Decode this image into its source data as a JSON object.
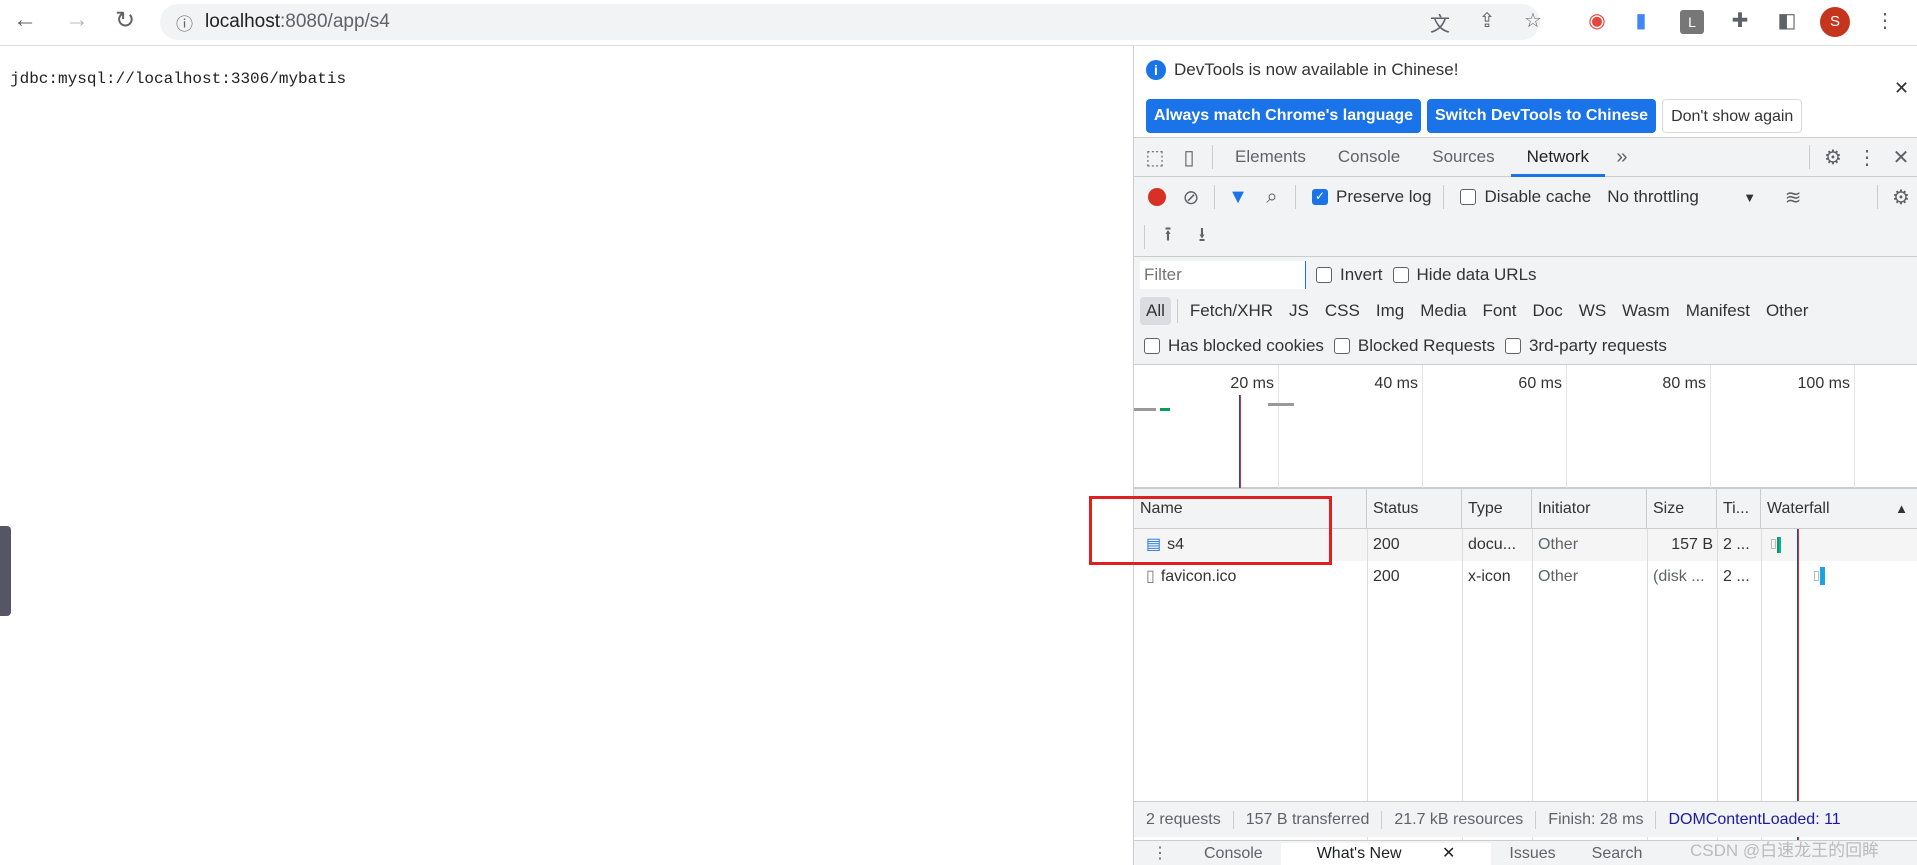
{
  "browser": {
    "url_host": "localhost",
    "url_path": ":8080/app/s4",
    "profile_initial": "S",
    "extension_initial": "L"
  },
  "page": {
    "text": "jdbc:mysql://localhost:3306/mybatis"
  },
  "devtools": {
    "banner": {
      "message": "DevTools is now available in Chinese!",
      "buttons": [
        "Always match Chrome's language",
        "Switch DevTools to Chinese",
        "Don't show again"
      ]
    },
    "tabs": [
      "Elements",
      "Console",
      "Sources",
      "Network"
    ],
    "active_tab": "Network",
    "toolbar": {
      "preserve_log": "Preserve log",
      "preserve_log_checked": true,
      "disable_cache": "Disable cache",
      "disable_cache_checked": false,
      "throttling": "No throttling"
    },
    "filter": {
      "placeholder": "Filter",
      "invert": "Invert",
      "hide_data_urls": "Hide data URLs"
    },
    "types": [
      "All",
      "Fetch/XHR",
      "JS",
      "CSS",
      "Img",
      "Media",
      "Font",
      "Doc",
      "WS",
      "Wasm",
      "Manifest",
      "Other"
    ],
    "active_type": "All",
    "blocked": [
      "Has blocked cookies",
      "Blocked Requests",
      "3rd-party requests"
    ],
    "overview_ticks": [
      "20 ms",
      "40 ms",
      "60 ms",
      "80 ms",
      "100 ms"
    ],
    "columns": [
      "Name",
      "Status",
      "Type",
      "Initiator",
      "Size",
      "Ti...",
      "Waterfall"
    ],
    "rows": [
      {
        "name": "s4",
        "status": "200",
        "type": "docu...",
        "initiator": "Other",
        "size": "157 B",
        "time": "2 ..."
      },
      {
        "name": "favicon.ico",
        "status": "200",
        "type": "x-icon",
        "initiator": "Other",
        "size": "(disk ...",
        "time": "2 ..."
      }
    ],
    "footer": {
      "requests": "2 requests",
      "transferred": "157 B transferred",
      "resources": "21.7 kB resources",
      "finish": "Finish: 28 ms",
      "dcl": "DOMContentLoaded: 11"
    },
    "drawer_tabs": [
      "Console",
      "What's New",
      "Issues",
      "Search"
    ]
  },
  "watermark": "CSDN @白速龙王的回眸",
  "colors": {
    "accent": "#1a73e8",
    "record": "#d93025",
    "highlight_box": "#e02020"
  }
}
